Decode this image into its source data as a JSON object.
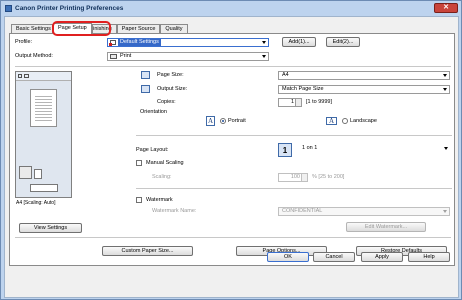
{
  "window": {
    "title": "Canon Printer Printing Preferences"
  },
  "tabs": [
    {
      "label": "Basic Settings"
    },
    {
      "label": "Page Setup"
    },
    {
      "label": "Finishing"
    },
    {
      "label": "Paper Source"
    },
    {
      "label": "Quality"
    }
  ],
  "profile": {
    "label": "Profile:",
    "value": "Default Settings",
    "add_label": "Add(1)...",
    "edit_label": "Edit(2)..."
  },
  "output_method": {
    "label": "Output Method:",
    "value": "Print"
  },
  "preview": {
    "caption": "A4 [Scaling: Auto]",
    "view_settings_label": "View Settings"
  },
  "page_size": {
    "label": "Page Size:",
    "value": "A4"
  },
  "output_size": {
    "label": "Output Size:",
    "value": "Match Page Size"
  },
  "copies": {
    "label": "Copies:",
    "value": "1",
    "range": "[1 to 9999]"
  },
  "orientation": {
    "label": "Orientation",
    "portrait_label": "Portrait",
    "landscape_label": "Landscape",
    "selected": "Portrait"
  },
  "page_layout": {
    "label": "Page Layout:",
    "value": "1 on 1",
    "number": "1"
  },
  "manual_scaling": {
    "label": "Manual Scaling",
    "scaling_label": "Scaling:",
    "scaling_value": "100",
    "scaling_range": "% [25 to 200]"
  },
  "watermark": {
    "label": "Watermark",
    "name_label": "Watermark Name:",
    "name_value": "CONFIDENTIAL",
    "edit_label": "Edit Watermark..."
  },
  "bottom_buttons": {
    "custom_paper": "Custom Paper Size...",
    "page_options": "Page Options...",
    "restore": "Restore Defaults"
  },
  "dialog_buttons": {
    "ok": "OK",
    "cancel": "Cancel",
    "apply": "Apply",
    "help": "Help"
  },
  "colors": {
    "highlight": "#e02020",
    "title_bar": "#bdd3ee"
  }
}
